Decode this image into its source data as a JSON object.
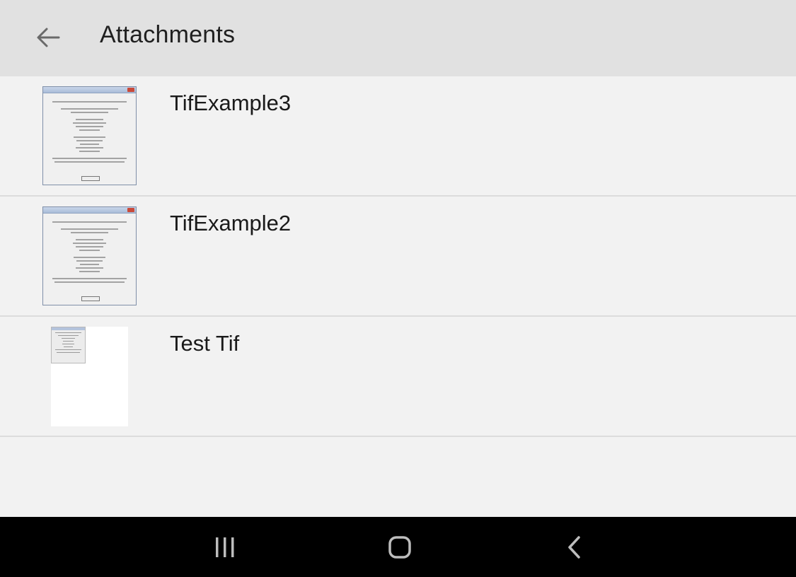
{
  "appbar": {
    "back_icon": "arrow-back-icon",
    "title": "Attachments"
  },
  "attachments": [
    {
      "name": "TifExample3",
      "thumbnail": "dialog-screenshot"
    },
    {
      "name": "TifExample2",
      "thumbnail": "dialog-screenshot"
    },
    {
      "name": "Test Tif",
      "thumbnail": "page-with-image"
    }
  ],
  "navbar": {
    "recents_icon": "recent-apps-icon",
    "home_icon": "home-icon",
    "back_icon": "back-chevron-icon"
  },
  "colors": {
    "appbar_bg": "#e1e1e1",
    "list_bg": "#f2f2f2",
    "divider": "#dcdcdc",
    "navbar_bg": "#000000"
  }
}
